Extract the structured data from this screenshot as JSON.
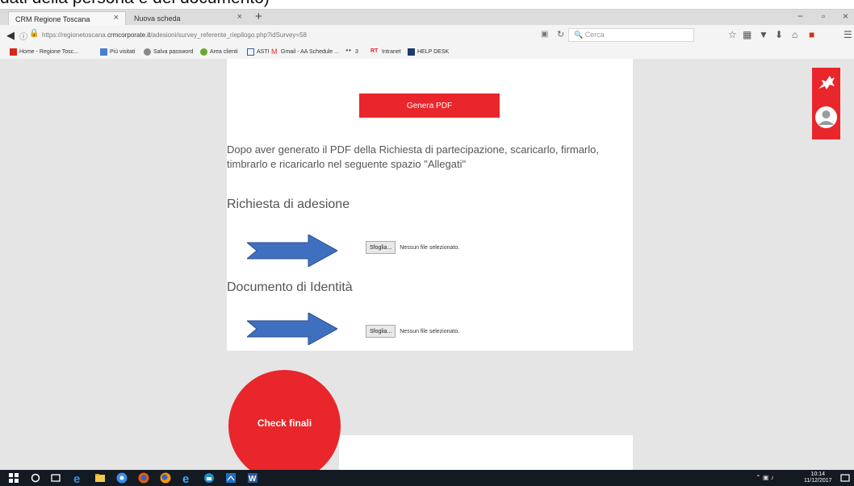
{
  "caption": "dati della persona e del documento)",
  "browser": {
    "tabs": [
      {
        "title": "CRM Regione Toscana",
        "close": "×"
      },
      {
        "title": "Nuova scheda",
        "close": "×"
      }
    ],
    "new_tab": "+",
    "window_controls": {
      "minimize": "−",
      "restore": "▫",
      "close": "×"
    },
    "url_prefix": "https://regionetoscana.",
    "url_domain": "crmcorporate.it",
    "url_path": "/adesioni/survey_referente_riepilogo.php?idSurvey=58",
    "search_placeholder": "Cerca",
    "icons": [
      "back-arrow-icon",
      "info-icon",
      "lock-icon",
      "reader-icon",
      "reload-icon",
      "star-icon",
      "library-icon",
      "pocket-icon",
      "download-icon",
      "home-icon",
      "pdf-icon",
      "menu-icon"
    ]
  },
  "bookmarks": [
    {
      "label": "Home - Regione Tosc...",
      "color": "#d9261c"
    },
    {
      "label": "Più visitati",
      "color": "#4a7fd0"
    },
    {
      "label": "Salva password",
      "color": "#888888"
    },
    {
      "label": "Area clienti",
      "color": "#6aa832"
    },
    {
      "label": "ASTI",
      "color": "#2a5db0"
    },
    {
      "label": "Gmail - AA Schedule ...",
      "color": "#d93025"
    },
    {
      "label": "3",
      "color": "#666666"
    },
    {
      "label": "Intranet",
      "color": "#d9261c"
    },
    {
      "label": "HELP DESK",
      "color": "#1d3b6e"
    }
  ],
  "page": {
    "genera_pdf": "Genera PDF",
    "instructions": "Dopo aver generato il PDF della Richiesta di partecipazione, scaricarlo, firmarlo, timbrarlo e ricaricarlo nel seguente spazio \"Allegati\"",
    "section1_title": "Richiesta di adesione",
    "section2_title": "Documento di Identità",
    "browse_label": "Sfoglia...",
    "no_file": "Nessun file selezionato.",
    "check_finali": "Check finali"
  },
  "colors": {
    "accent_red": "#e8262b",
    "arrow_blue": "#3f6fbf"
  },
  "taskbar": {
    "time": "10:14",
    "date": "11/12/2017"
  }
}
